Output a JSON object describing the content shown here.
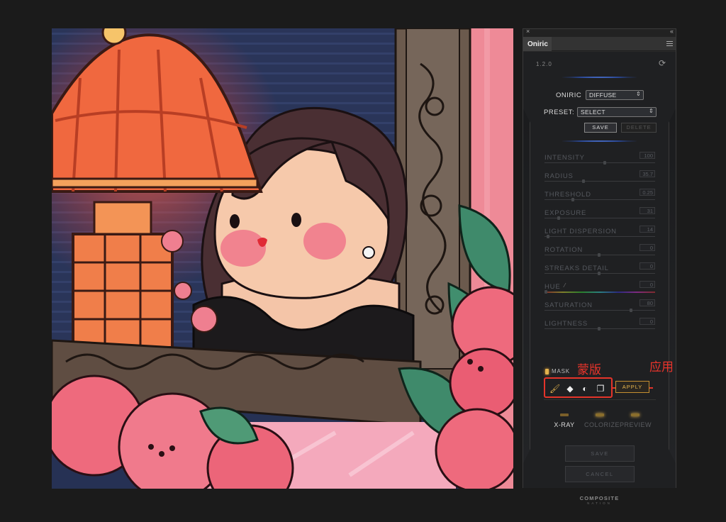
{
  "panel": {
    "close_glyph": "×",
    "collapse_glyph": "‹‹",
    "tab": "Oniric",
    "version": "1.2.0",
    "oniric_label": "ONIRIC",
    "oniric_select": "DIFFUSE",
    "preset_label": "PRESET:",
    "preset_select": "SELECT",
    "save_small": "SAVE",
    "delete_small": "DELETE",
    "sliders": [
      {
        "name": "INTENSITY",
        "value": "100",
        "fraction": 0.55
      },
      {
        "name": "RADIUS",
        "value": "35.7",
        "fraction": 0.35
      },
      {
        "name": "THRESHOLD",
        "value": "0.25",
        "fraction": 0.25
      },
      {
        "name": "EXPOSURE",
        "value": "31",
        "fraction": 0.12
      },
      {
        "name": "LIGHT DISPERSION",
        "value": "14",
        "fraction": 0.02
      },
      {
        "name": "ROTATION",
        "value": "0",
        "fraction": 0.5
      },
      {
        "name": "STREAKS DETAIL",
        "value": "0",
        "fraction": 0.5
      },
      {
        "name": "HUE",
        "value": "0",
        "fraction": 0.0
      },
      {
        "name": "SATURATION",
        "value": "80",
        "fraction": 0.8
      },
      {
        "name": "LIGHTNESS",
        "value": "0",
        "fraction": 0.5
      }
    ],
    "mask_label": "MASK",
    "mask_annotation": "蒙版",
    "apply_label": "APPLY",
    "apply_annotation": "应用",
    "modes": [
      {
        "label": "X-RAY",
        "active": true
      },
      {
        "label": "COLORIZE",
        "active": false
      },
      {
        "label": "PREVIEW",
        "active": false
      }
    ],
    "save_button": "SAVE",
    "cancel_button": "CANCEL",
    "brand_line1": "COMPOSITE",
    "brand_line2": "NATION",
    "icons": [
      "brush-icon",
      "eraser-icon",
      "contrast-icon",
      "copy-mask-icon",
      "refresh-icon",
      "eyedropper-icon",
      "panel-menu-icon"
    ]
  },
  "colors": {
    "accent_gold": "#e3b34e",
    "annotation_red": "#e5342a",
    "panel_bg": "#1f2022",
    "page_bg": "#1b1b1b"
  }
}
